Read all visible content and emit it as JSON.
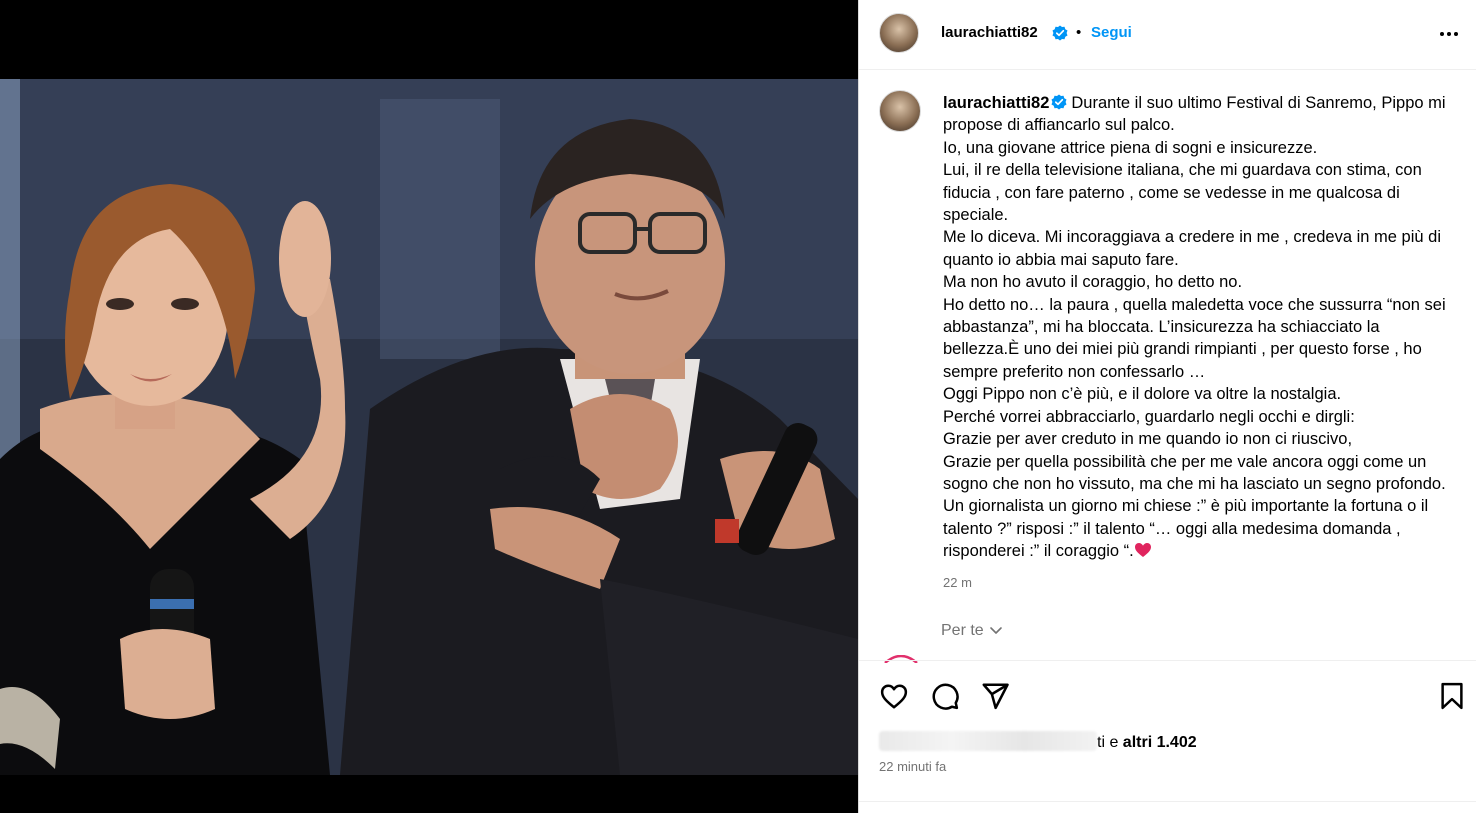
{
  "post": {
    "username": "laurachiatti82",
    "follow_label": "Segui",
    "separator": "•",
    "caption_lines": [
      "Durante il suo ultimo Festival di Sanremo, Pippo mi propose di affiancarlo sul palco.",
      "Io, una giovane attrice piena di sogni e insicurezze.",
      "Lui, il re della televisione italiana, che mi guardava con stima, con fiducia , con fare paterno , come se vedesse in me qualcosa di speciale.",
      "Me lo diceva. Mi incoraggiava a credere in me , credeva in me più di quanto io abbia mai saputo fare.",
      "Ma non ho avuto il coraggio, ho detto no.",
      "Ho detto no… la paura , quella maledetta voce che sussurra “non sei abbastanza”, mi ha bloccata. L’insicurezza ha schiacciato la bellezza.È uno dei miei più grandi rimpianti , per questo forse , ho sempre preferito non confessarlo …",
      "Oggi Pippo non c’è più, e il dolore va oltre la nostalgia.",
      "Perché vorrei abbracciarlo, guardarlo negli occhi e dirgli:",
      "Grazie per aver creduto in me quando io non ci riuscivo,",
      "Grazie per quella possibilità che per me vale ancora oggi come un sogno che non ho vissuto, ma che mi ha lasciato un segno profondo. Un giornalista un giorno mi chiese :” è più importante la fortuna o il talento ?” risposi :” il talento “… oggi alla medesima domanda , risponderei :” il coraggio “."
    ],
    "caption_time": "22 m",
    "for_you_label": "Per te",
    "likes_partial_name": "ti",
    "likes_connector": " e ",
    "likes_others": "altri 1.402",
    "posted_time": "22 minuti fa"
  },
  "icons": {
    "verified": "verified-badge-icon",
    "more": "more-options-icon",
    "like": "heart-icon",
    "comment": "comment-icon",
    "share": "share-icon",
    "save": "bookmark-icon",
    "chevron": "chevron-down-icon",
    "caption_end": "red-heart-emoji-icon"
  },
  "colors": {
    "link_blue": "#0095f6",
    "verified_blue": "#0095f6",
    "muted_text": "#737373",
    "heart_red": "#e0245e"
  }
}
